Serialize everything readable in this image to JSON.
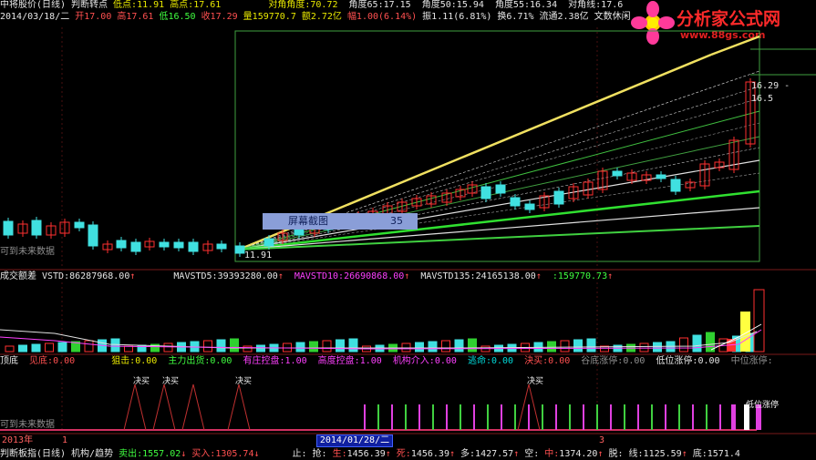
{
  "header1": {
    "title": "中将股价(日线)",
    "title2": "判断转点",
    "low_label": "低点:",
    "low": "11.91",
    "high_label": "高点:",
    "high": "17.61",
    "angles": [
      {
        "label": "对角角度:",
        "value": "70.72"
      },
      {
        "label": "角度65:",
        "value": "17.15"
      },
      {
        "label": "角度50:",
        "value": "15.94"
      },
      {
        "label": "角度55:",
        "value": "16.34"
      },
      {
        "label": "对角线:",
        "value": "17.6"
      }
    ]
  },
  "header2": {
    "date": "2014/03/18/二",
    "open": "开17.00",
    "high": "高17.61",
    "low": "低16.50",
    "close": "收17.29",
    "vol": "量159770.7",
    "amount": "额2.72亿",
    "change": "幅1.00(6.14%)",
    "amp": "振1.11(6.81%)",
    "turnover": "换6.71%",
    "float": "流通2.38亿",
    "tail": "文数休闲"
  },
  "logo": {
    "name": "分析家公式网",
    "url": "www.88gs.com"
  },
  "tooltip": {
    "label": "屏幕截图",
    "value": "35"
  },
  "price_tag": "16.29 - 16.5",
  "price_low_label": "11.91",
  "future_label": "可到未来数据",
  "vol_panel": {
    "name": "成交额差",
    "vstd_label": "VSTD:",
    "vstd": "86287968.00",
    "mavstd5_label": "MAVSTD5:",
    "mavstd5": "39393280.00",
    "mavstd10_label": "MAVSTD10:",
    "mavstd10": "26690868.00",
    "mavstd135_label": "MAVSTD135:",
    "mavstd135": "24165138.00",
    "last_label": ":",
    "last": "159770.73"
  },
  "signal_panel": {
    "items": [
      {
        "label": "顶底",
        "value": ""
      },
      {
        "label": "见底:",
        "value": "0.00"
      },
      {
        "label": "狙击:",
        "value": "0.00"
      },
      {
        "label": "主力出货:",
        "value": "0.00"
      },
      {
        "label": "有庄控盘:",
        "value": "1.00"
      },
      {
        "label": "高度控盘:",
        "value": "1.00"
      },
      {
        "label": "机构介入:",
        "value": "0.00"
      },
      {
        "label": "逃命:",
        "value": "0.00"
      },
      {
        "label": "決买:",
        "value": "0.00"
      },
      {
        "label": "谷底涨停:",
        "value": "0.00"
      },
      {
        "label": "低位涨停:",
        "value": "0.00"
      },
      {
        "label": "中位涨停:",
        "value": ""
      }
    ],
    "buy_label": "决买",
    "limit_label": "低位涨停",
    "future_label": "可到未来数据"
  },
  "axis": {
    "year": "2013年",
    "month1": "1",
    "cursor_date": "2014/01/28/二",
    "month3": "3"
  },
  "bottom": {
    "name": "判断板指(日线)",
    "name2": "机构/趋势",
    "items": [
      {
        "label": "卖出:",
        "value": "1557.02"
      },
      {
        "label": "买入:",
        "value": "1305.74"
      },
      {
        "label": "止:",
        "value": ""
      },
      {
        "label": "抢:",
        "value": ""
      },
      {
        "label": "生:",
        "value": "1456.39"
      },
      {
        "label": "死:",
        "value": "1456.39"
      },
      {
        "label": "多:",
        "value": "1427.57"
      },
      {
        "label": "空:",
        "value": ""
      },
      {
        "label": "中:",
        "value": "1374.20"
      },
      {
        "label": "脱:",
        "value": ""
      },
      {
        "label": "线:",
        "value": "1125.59"
      },
      {
        "label": "底:",
        "value": "1571.4"
      }
    ]
  },
  "colors": {
    "up": "#ff3030",
    "down": "#40e0e0",
    "yellow": "#ffff40",
    "green": "#40ff40",
    "magenta": "#ff40ff",
    "grid": "#7a1a1a"
  }
}
